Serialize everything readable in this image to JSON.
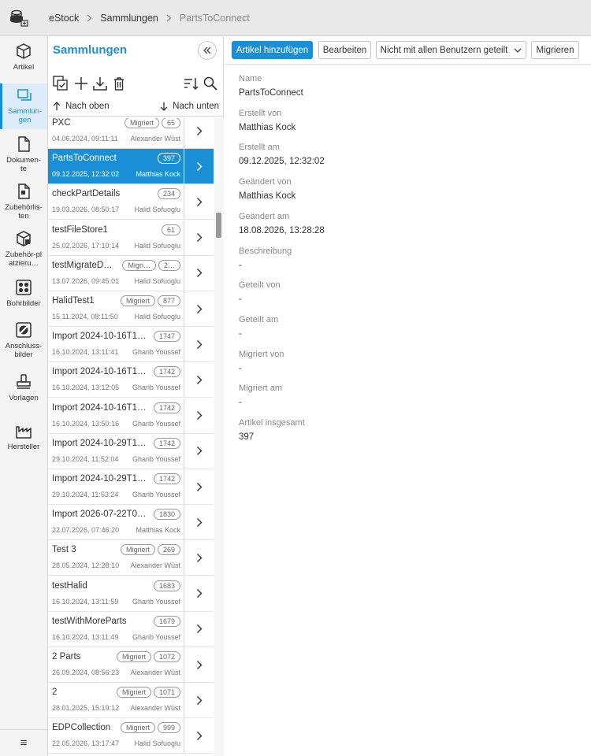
{
  "breadcrumb": [
    "eStock",
    "Sammlungen",
    "PartsToConnect"
  ],
  "nav": {
    "items": [
      {
        "label": "Artikel",
        "icon": "cube-icon"
      },
      {
        "label": "Sammlun-gen",
        "icon": "collections-icon",
        "active": true
      },
      {
        "label": "Dokumen-te",
        "icon": "document-icon"
      },
      {
        "label": "Zubehörlis-ten",
        "icon": "accessory-list-icon"
      },
      {
        "label": "Zubehör-platzieru…",
        "icon": "accessory-placement-icon"
      },
      {
        "label": "Bohrbilder",
        "icon": "drill-pattern-icon"
      },
      {
        "label": "Anschluss-bilder",
        "icon": "connection-icon"
      },
      {
        "label": "Vorlagen",
        "icon": "stamp-icon"
      },
      {
        "label": "Hersteller",
        "icon": "factory-icon"
      }
    ],
    "menu_icon": "≡"
  },
  "panel": {
    "title": "Sammlungen",
    "sort_up": "Nach oben",
    "sort_down": "Nach unten"
  },
  "collections": [
    {
      "name": "PXC",
      "date": "04.06.2024, 09:11:11",
      "user": "Alexander Wüst",
      "migrated": "Migriert",
      "count": "65"
    },
    {
      "name": "PartsToConnect",
      "date": "09.12.2025, 12:32:02",
      "user": "Matthias Kock",
      "migrated": "",
      "count": "397",
      "selected": true
    },
    {
      "name": "checkPartDetails",
      "date": "19.03.2026, 08:50:17",
      "user": "Halid Sofuoglu",
      "migrated": "",
      "count": "234"
    },
    {
      "name": "testFileStore1",
      "date": "25.02.2026, 17:10:14",
      "user": "Halid Sofuoglu",
      "migrated": "",
      "count": "61"
    },
    {
      "name": "testMigrateD…",
      "date": "13.07.2026, 09:45:01",
      "user": "Halid Sofuoglu",
      "migrated": "Migri…",
      "count": "2…"
    },
    {
      "name": "HalidTest1",
      "date": "15.11.2024, 08:11:50",
      "user": "Halid Sofuoglu",
      "migrated": "Migriert",
      "count": "877"
    },
    {
      "name": "Import 2024-10-16T1…",
      "date": "16.10.2024, 13:11:41",
      "user": "Gharib Youssef",
      "migrated": "",
      "count": "1747"
    },
    {
      "name": "Import 2024-10-16T1…",
      "date": "16.10.2024, 13:12:05",
      "user": "Gharib Youssef",
      "migrated": "",
      "count": "1742"
    },
    {
      "name": "Import 2024-10-16T1…",
      "date": "16.10.2024, 13:50:16",
      "user": "Gharib Youssef",
      "migrated": "",
      "count": "1742"
    },
    {
      "name": "Import 2024-10-29T1…",
      "date": "29.10.2024, 11:52:04",
      "user": "Gharib Youssef",
      "migrated": "",
      "count": "1742"
    },
    {
      "name": "Import 2024-10-29T1…",
      "date": "29.10.2024, 11:53:24",
      "user": "Gharib Youssef",
      "migrated": "",
      "count": "1742"
    },
    {
      "name": "Import 2026-07-22T0…",
      "date": "22.07.2026, 07:46:20",
      "user": "Matthias Kock",
      "migrated": "",
      "count": "1830"
    },
    {
      "name": "Test 3",
      "date": "28.05.2024, 12:28:10",
      "user": "Alexander Wüst",
      "migrated": "Migriert",
      "count": "269"
    },
    {
      "name": "testHalid",
      "date": "16.10.2024, 13:11:59",
      "user": "Gharib Youssef",
      "migrated": "",
      "count": "1683"
    },
    {
      "name": "testWithMoreParts",
      "date": "16.10.2024, 13:11:49",
      "user": "Gharib Youssef",
      "migrated": "",
      "count": "1679"
    },
    {
      "name": "2 Parts",
      "date": "26.09.2024, 08:56:23",
      "user": "Alexander Wüst",
      "migrated": "Migriert",
      "count": "1072"
    },
    {
      "name": "2",
      "date": "28.01.2025, 15:19:12",
      "user": "Alexander Wüst",
      "migrated": "Migriert",
      "count": "1071"
    },
    {
      "name": "EDPCollection",
      "date": "22.05.2026, 13:17:47",
      "user": "Halid Sofuoglu",
      "migrated": "Migriert",
      "count": "999"
    }
  ],
  "toolbar": {
    "add_label": "Artikel hinzufügen",
    "edit_label": "Bearbeiten",
    "share_label": "Nicht mit allen Benutzern geteilt",
    "migrate_label": "Migrieren"
  },
  "details": [
    {
      "label": "Name",
      "value": "PartsToConnect"
    },
    {
      "label": "Erstellt von",
      "value": "Matthias Kock"
    },
    {
      "label": "Erstellt am",
      "value": "09.12.2025, 12:32:02"
    },
    {
      "label": "Geändert von",
      "value": "Matthias Kock"
    },
    {
      "label": "Geändert am",
      "value": "18.08.2026, 13:28:28"
    },
    {
      "label": "Beschreibung",
      "value": "-"
    },
    {
      "label": "Geteilt von",
      "value": "-"
    },
    {
      "label": "Geteilt am",
      "value": "-"
    },
    {
      "label": "Migriert von",
      "value": "-"
    },
    {
      "label": "Migriert am",
      "value": "-"
    },
    {
      "label": "Artikel insgesamt",
      "value": "397"
    }
  ],
  "colors": {
    "accent": "#1a8fd6",
    "active_nav_bg": "#dcecf8"
  }
}
